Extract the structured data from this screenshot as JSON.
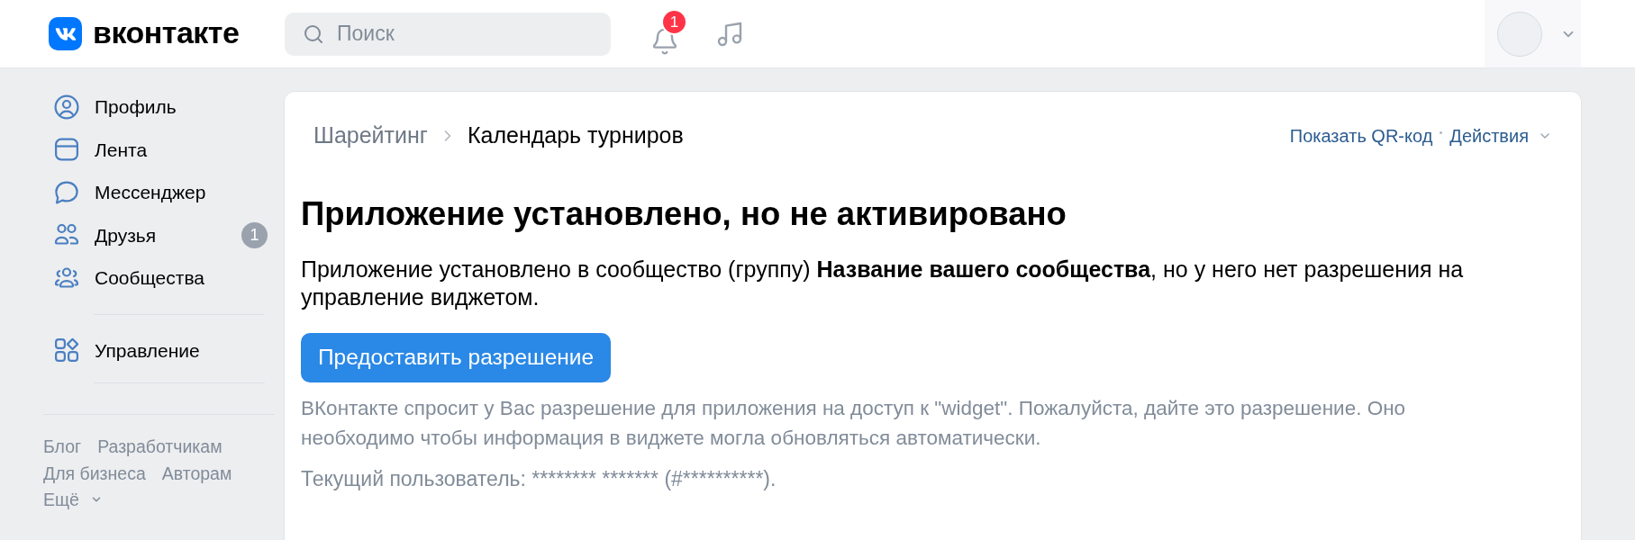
{
  "header": {
    "logo": "вконтакте",
    "search": {
      "placeholder": "Поиск"
    },
    "notification_count": "1"
  },
  "sidebar": {
    "sections": [
      {
        "items": [
          {
            "label": "Профиль"
          },
          {
            "label": "Лента"
          },
          {
            "label": "Мессенджер"
          },
          {
            "label": "Друзья",
            "count": "1"
          },
          {
            "label": "Сообщества"
          }
        ]
      },
      {
        "items": [
          {
            "label": "Управление"
          }
        ]
      }
    ],
    "footer_links": [
      "Блог",
      "Разработчикам",
      "Для бизнеса",
      "Авторам"
    ],
    "more": "Ещё"
  },
  "page": {
    "breadcrumb": {
      "parent": "Шарейтинг",
      "current": "Календарь турниров"
    },
    "actions": {
      "qr_link": "Показать QR-код",
      "menu": "Действия"
    },
    "title": "Приложение установлено, но не активировано",
    "message": "Приложение установлено в сообщество (группу) **Название вашего сообщества**, но у него нет разрешения на управление виджетом.",
    "button": "Предоставить разрешение",
    "note": "ВКонтакте спросит у Вас разрешение для приложения на доступ к \"widget\". Пожалуйста, дайте это разрешение. Оно необходимо чтобы информация в виджете могла обновляться автоматически.",
    "current_user": "Текущий пользователь: ******** ******* (#**********)."
  }
}
